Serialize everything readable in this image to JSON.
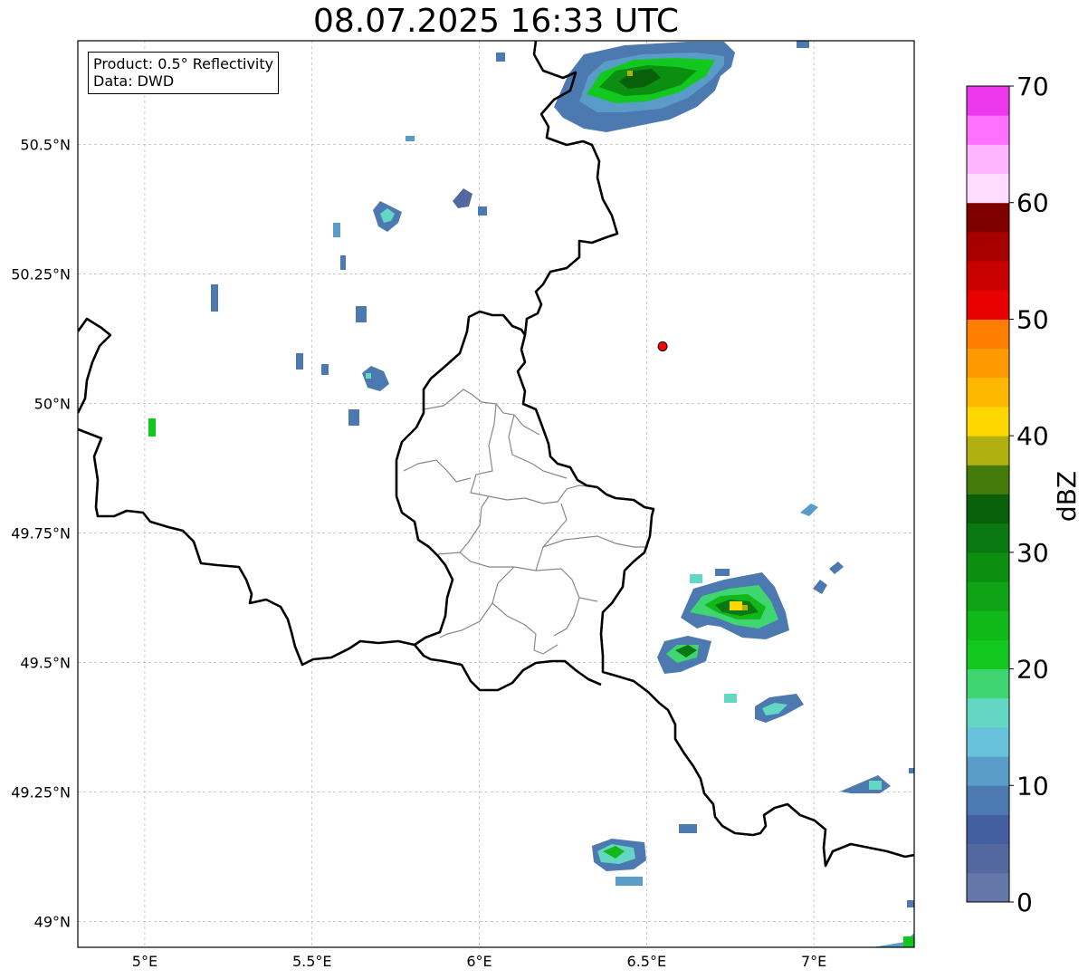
{
  "title": "08.07.2025 16:33 UTC",
  "info": {
    "product": "Product: 0.5° Reflectivity",
    "data": "Data: DWD"
  },
  "map": {
    "lon_range": [
      4.8,
      7.3
    ],
    "lat_range": [
      48.95,
      50.7
    ],
    "lon_ticks": [
      {
        "value": 5.0,
        "label": "5°E"
      },
      {
        "value": 5.5,
        "label": "5.5°E"
      },
      {
        "value": 6.0,
        "label": "6°E"
      },
      {
        "value": 6.5,
        "label": "6.5°E"
      },
      {
        "value": 7.0,
        "label": "7°E"
      }
    ],
    "lat_ticks": [
      {
        "value": 49.0,
        "label": "49°N"
      },
      {
        "value": 49.25,
        "label": "49.25°N"
      },
      {
        "value": 49.5,
        "label": "49.5°N"
      },
      {
        "value": 49.75,
        "label": "49.75°N"
      },
      {
        "value": 50.0,
        "label": "50°N"
      },
      {
        "value": 50.25,
        "label": "50.25°N"
      },
      {
        "value": 50.5,
        "label": "50.5°N"
      }
    ],
    "grid": true,
    "radar_site": {
      "lon": 6.548,
      "lat": 50.11,
      "color": "#ff0000"
    }
  },
  "colorbar": {
    "label": "dBZ",
    "range": [
      0,
      70
    ],
    "ticks": [
      {
        "value": 0,
        "label": "0"
      },
      {
        "value": 10,
        "label": "10"
      },
      {
        "value": 20,
        "label": "20"
      },
      {
        "value": 30,
        "label": "30"
      },
      {
        "value": 40,
        "label": "40"
      },
      {
        "value": 50,
        "label": "50"
      },
      {
        "value": 60,
        "label": "60"
      },
      {
        "value": 70,
        "label": "70"
      }
    ],
    "colors": [
      "#6576a8",
      "#5468a0",
      "#445ea2",
      "#4c7ab0",
      "#5a9cc8",
      "#68c2dc",
      "#64d6c4",
      "#3fd672",
      "#12c81e",
      "#10b818",
      "#0ea214",
      "#0c8e10",
      "#0a7810",
      "#08600a",
      "#447a0a",
      "#b0b010",
      "#fed600",
      "#feb800",
      "#fe9a00",
      "#fe7e00",
      "#e80000",
      "#c80000",
      "#a80000",
      "#800000",
      "#ffdcff",
      "#ffb4ff",
      "#ff70ff",
      "#ee38ee"
    ]
  },
  "chart_data": {
    "type": "heatmap",
    "title": "08.07.2025 16:33 UTC",
    "colorbar_label": "dBZ",
    "colorbar_range": [
      0,
      70
    ],
    "x_axis": {
      "unit": "°E",
      "ticks": [
        5.0,
        5.5,
        6.0,
        6.5,
        7.0
      ],
      "range": [
        4.8,
        7.3
      ]
    },
    "y_axis": {
      "unit": "°N",
      "ticks": [
        49.0,
        49.25,
        49.5,
        49.75,
        50.0,
        50.25,
        50.5
      ],
      "range": [
        48.95,
        50.7
      ]
    },
    "echo_cells": [
      {
        "lon": 6.72,
        "lat": 50.62,
        "dbz": 38
      },
      {
        "lon": 6.78,
        "lat": 49.62,
        "dbz": 42
      },
      {
        "lon": 6.63,
        "lat": 49.54,
        "dbz": 30
      },
      {
        "lon": 6.4,
        "lat": 49.14,
        "dbz": 25
      },
      {
        "lon": 5.72,
        "lat": 50.37,
        "dbz": 18
      },
      {
        "lon": 5.96,
        "lat": 50.4,
        "dbz": 10
      },
      {
        "lon": 5.03,
        "lat": 49.96,
        "dbz": 22
      },
      {
        "lon": 5.7,
        "lat": 50.05,
        "dbz": 12
      },
      {
        "lon": 6.9,
        "lat": 49.44,
        "dbz": 14
      },
      {
        "lon": 7.15,
        "lat": 49.27,
        "dbz": 16
      }
    ]
  }
}
